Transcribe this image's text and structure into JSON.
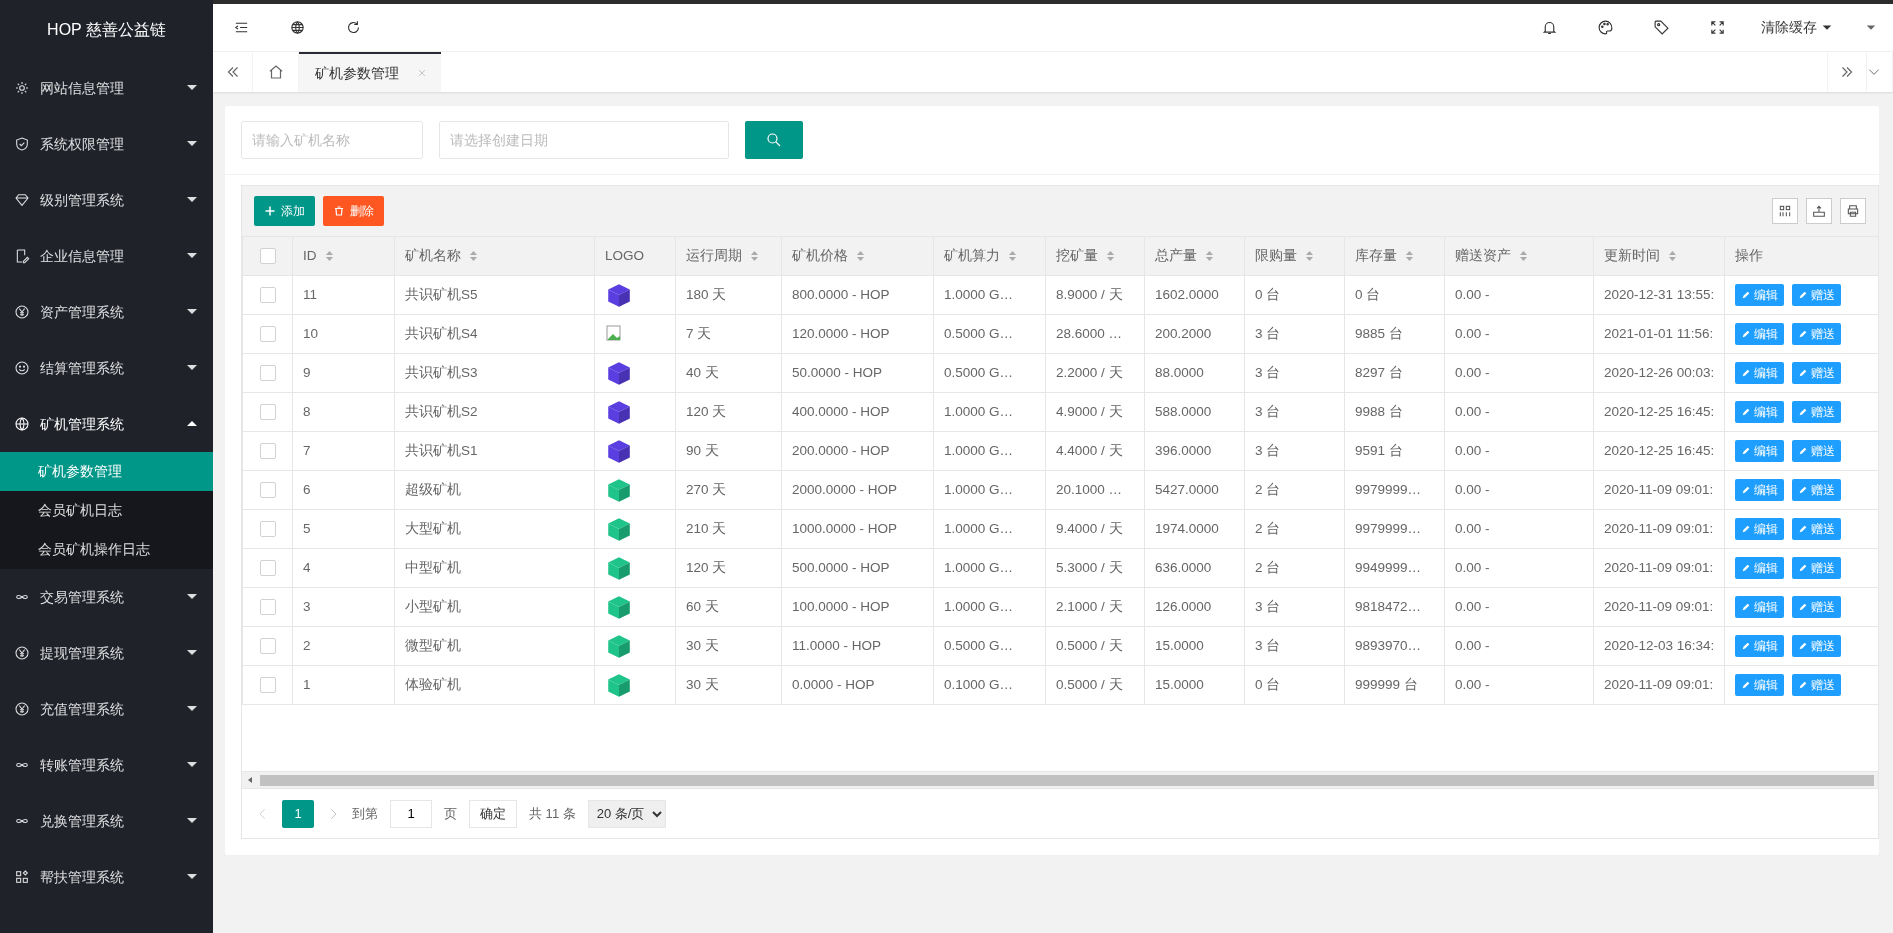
{
  "sidebar": {
    "brand": "HOP 慈善公益链",
    "items": [
      {
        "label": "网站信息管理",
        "expanded": false
      },
      {
        "label": "系统权限管理",
        "expanded": false
      },
      {
        "label": "级别管理系统",
        "expanded": false
      },
      {
        "label": "企业信息管理",
        "expanded": false
      },
      {
        "label": "资产管理系统",
        "expanded": false
      },
      {
        "label": "结算管理系统",
        "expanded": false
      },
      {
        "label": "矿机管理系统",
        "expanded": true,
        "children": [
          {
            "label": "矿机参数管理",
            "selected": true
          },
          {
            "label": "会员矿机日志",
            "selected": false
          },
          {
            "label": "会员矿机操作日志",
            "selected": false
          }
        ]
      },
      {
        "label": "交易管理系统",
        "expanded": false
      },
      {
        "label": "提现管理系统",
        "expanded": false
      },
      {
        "label": "充值管理系统",
        "expanded": false
      },
      {
        "label": "转账管理系统",
        "expanded": false
      },
      {
        "label": "兑换管理系统",
        "expanded": false
      },
      {
        "label": "帮扶管理系统",
        "expanded": false
      }
    ]
  },
  "header": {
    "clear_cache": "清除缓存"
  },
  "tabs": [
    {
      "label": "矿机参数管理",
      "selected": true
    }
  ],
  "search": {
    "name_placeholder": "请输入矿机名称",
    "date_placeholder": "请选择创建日期"
  },
  "toolbar": {
    "add": "添加",
    "delete": "删除"
  },
  "table": {
    "select_all": {
      "checked": false
    },
    "columns": [
      {
        "label": "ID",
        "sortable": true
      },
      {
        "label": "矿机名称",
        "sortable": true
      },
      {
        "label": "LOGO",
        "sortable": false
      },
      {
        "label": "运行周期",
        "sortable": true
      },
      {
        "label": "矿机价格",
        "sortable": true
      },
      {
        "label": "矿机算力",
        "sortable": true
      },
      {
        "label": "挖矿量",
        "sortable": true
      },
      {
        "label": "总产量",
        "sortable": true
      },
      {
        "label": "限购量",
        "sortable": true
      },
      {
        "label": "库存量",
        "sortable": true
      },
      {
        "label": "赠送资产",
        "sortable": true
      },
      {
        "label": "更新时间",
        "sortable": true
      },
      {
        "label": "操作",
        "sortable": false
      }
    ],
    "rows": [
      {
        "checked": false,
        "cells": [
          "11",
          "共识矿机S5"
        ],
        "logo": {
          "kind": "cube",
          "color": "#5a3ee0"
        },
        "values": [
          "180 天",
          "800.0000 - HOP",
          "1.0000 G…",
          "8.9000 / 天",
          "1602.0000",
          "0 台",
          "0 台",
          "0.00 -",
          "2020-12-31 13:55:"
        ],
        "actions": [
          "编辑",
          "赠送"
        ]
      },
      {
        "checked": false,
        "cells": [
          "10",
          "共识矿机S4"
        ],
        "logo": {
          "kind": "broken"
        },
        "values": [
          "7 天",
          "120.0000 - HOP",
          "0.5000 G…",
          "28.6000 …",
          "200.2000",
          "3 台",
          "9885 台",
          "0.00 -",
          "2021-01-01 11:56:"
        ],
        "actions": [
          "编辑",
          "赠送"
        ]
      },
      {
        "checked": false,
        "cells": [
          "9",
          "共识矿机S3"
        ],
        "logo": {
          "kind": "cube",
          "color": "#5a3ee0"
        },
        "values": [
          "40 天",
          "50.0000 - HOP",
          "0.5000 G…",
          "2.2000 / 天",
          "88.0000",
          "3 台",
          "8297 台",
          "0.00 -",
          "2020-12-26 00:03:"
        ],
        "actions": [
          "编辑",
          "赠送"
        ]
      },
      {
        "checked": false,
        "cells": [
          "8",
          "共识矿机S2"
        ],
        "logo": {
          "kind": "cube",
          "color": "#5a3ee0"
        },
        "values": [
          "120 天",
          "400.0000 - HOP",
          "1.0000 G…",
          "4.9000 / 天",
          "588.0000",
          "3 台",
          "9988 台",
          "0.00 -",
          "2020-12-25 16:45:"
        ],
        "actions": [
          "编辑",
          "赠送"
        ]
      },
      {
        "checked": false,
        "cells": [
          "7",
          "共识矿机S1"
        ],
        "logo": {
          "kind": "cube",
          "color": "#5a3ee0"
        },
        "values": [
          "90 天",
          "200.0000 - HOP",
          "1.0000 G…",
          "4.4000 / 天",
          "396.0000",
          "3 台",
          "9591 台",
          "0.00 -",
          "2020-12-25 16:45:"
        ],
        "actions": [
          "编辑",
          "赠送"
        ]
      },
      {
        "checked": false,
        "cells": [
          "6",
          "超级矿机"
        ],
        "logo": {
          "kind": "cube",
          "color": "#1fc48a"
        },
        "values": [
          "270 天",
          "2000.0000 - HOP",
          "1.0000 G…",
          "20.1000 …",
          "5427.0000",
          "2 台",
          "9979999…",
          "0.00 -",
          "2020-11-09 09:01:"
        ],
        "actions": [
          "编辑",
          "赠送"
        ]
      },
      {
        "checked": false,
        "cells": [
          "5",
          "大型矿机"
        ],
        "logo": {
          "kind": "cube",
          "color": "#1fc48a"
        },
        "values": [
          "210 天",
          "1000.0000 - HOP",
          "1.0000 G…",
          "9.4000 / 天",
          "1974.0000",
          "2 台",
          "9979999…",
          "0.00 -",
          "2020-11-09 09:01:"
        ],
        "actions": [
          "编辑",
          "赠送"
        ]
      },
      {
        "checked": false,
        "cells": [
          "4",
          "中型矿机"
        ],
        "logo": {
          "kind": "cube",
          "color": "#1fc48a"
        },
        "values": [
          "120 天",
          "500.0000 - HOP",
          "1.0000 G…",
          "5.3000 / 天",
          "636.0000",
          "2 台",
          "9949999…",
          "0.00 -",
          "2020-11-09 09:01:"
        ],
        "actions": [
          "编辑",
          "赠送"
        ]
      },
      {
        "checked": false,
        "cells": [
          "3",
          "小型矿机"
        ],
        "logo": {
          "kind": "cube",
          "color": "#1fc48a"
        },
        "values": [
          "60 天",
          "100.0000 - HOP",
          "1.0000 G…",
          "2.1000 / 天",
          "126.0000",
          "3 台",
          "9818472…",
          "0.00 -",
          "2020-11-09 09:01:"
        ],
        "actions": [
          "编辑",
          "赠送"
        ]
      },
      {
        "checked": false,
        "cells": [
          "2",
          "微型矿机"
        ],
        "logo": {
          "kind": "cube",
          "color": "#1fc48a"
        },
        "values": [
          "30 天",
          "11.0000 - HOP",
          "0.5000 G…",
          "0.5000 / 天",
          "15.0000",
          "3 台",
          "9893970…",
          "0.00 -",
          "2020-12-03 16:34:"
        ],
        "actions": [
          "编辑",
          "赠送"
        ]
      },
      {
        "checked": false,
        "cells": [
          "1",
          "体验矿机"
        ],
        "logo": {
          "kind": "cube",
          "color": "#1fc48a"
        },
        "values": [
          "30 天",
          "0.0000 - HOP",
          "0.1000 G…",
          "0.5000 / 天",
          "15.0000",
          "0 台",
          "999999 台",
          "0.00 -",
          "2020-11-09 09:01:"
        ],
        "actions": [
          "编辑",
          "赠送"
        ]
      }
    ]
  },
  "pagination": {
    "pages": [
      {
        "label": "1",
        "selected": true
      }
    ],
    "goto_label": "到第",
    "goto_value": "1",
    "page_unit": "页",
    "confirm": "确定",
    "total": "共 11 条",
    "page_size": "20 条/页"
  }
}
